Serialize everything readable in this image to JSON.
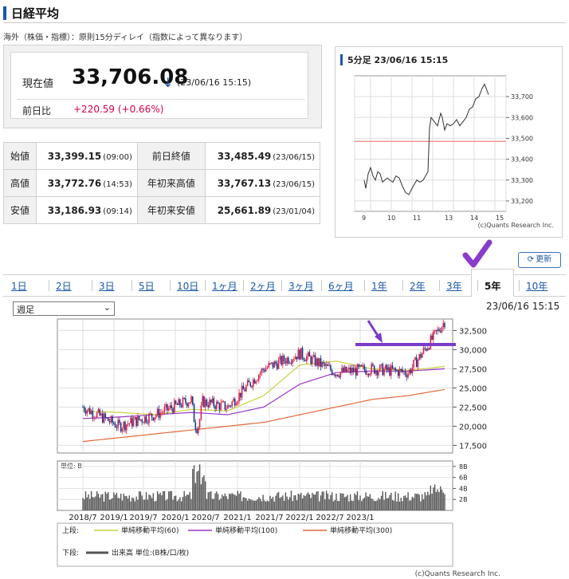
{
  "header": {
    "title": "日経平均",
    "notice": "海外（株価・指標）：原則15分ディレイ（指数によって異なります）"
  },
  "price": {
    "label": "現在値",
    "value": "33,706.08",
    "arrow": "↓",
    "time": "(23/06/16 15:15)",
    "change_label": "前日比",
    "change_value": "+220.59 (+0.66%)",
    "change_color": "#d2004f"
  },
  "stats": {
    "rows": [
      {
        "l1": "始値",
        "v1": "33,399.15",
        "t1": "(09:00)",
        "l2": "前日終値",
        "v2": "33,485.49",
        "t2": "(23/06/15)"
      },
      {
        "l1": "高値",
        "v1": "33,772.76",
        "t1": "(14:53)",
        "l2": "年初来高値",
        "v2": "33,767.13",
        "t2": "(23/06/15)"
      },
      {
        "l1": "安値",
        "v1": "33,186.93",
        "t1": "(09:14)",
        "l2": "年初来安値",
        "v2": "25,661.89",
        "t2": "(23/01/04)"
      }
    ]
  },
  "intraday": {
    "title": "5分足 23/06/16 15:15",
    "copyright": "(c)Quants Research Inc.",
    "yticks": [
      "33,700",
      "33,600",
      "33,500",
      "33,400",
      "33,300",
      "33,200"
    ],
    "xticks": [
      "9",
      "10",
      "11",
      "13",
      "14",
      "15"
    ]
  },
  "refresh": {
    "label": "更新",
    "icon": "refresh-icon"
  },
  "tabs": [
    "1日",
    "2日",
    "3日",
    "5日",
    "10日",
    "1ヶ月",
    "2ヶ月",
    "3ヶ月",
    "6ヶ月",
    "1年",
    "2年",
    "3年",
    "5年",
    "10年"
  ],
  "active_tab": "5年",
  "period_select": {
    "value": "週足"
  },
  "main_chart": {
    "time": "23/06/16 15:15",
    "yticks": [
      "32,500",
      "30,000",
      "27,500",
      "25,000",
      "22,500",
      "20,000",
      "17,500"
    ],
    "xticks": [
      "2018/7",
      "2019/1",
      "2019/7",
      "2020/1",
      "2020/7",
      "2021/1",
      "2021/7",
      "2022/1",
      "2022/7",
      "2023/1"
    ],
    "volume_unit": "単位: B",
    "volume_ticks": [
      "8B",
      "6B",
      "4B",
      "2B"
    ],
    "legend_upper": "上段:",
    "legend_lower": "下段:",
    "ma60": "単純移動平均(60)",
    "ma100": "単純移動平均(100)",
    "ma300": "単純移動平均(300)",
    "volume_legend": "出来高 単位:(B株/口/枚)",
    "copyright": "(c)Quants Research Inc.",
    "colors": {
      "ma60": "#c8d43a",
      "ma100": "#9a36c8",
      "ma300": "#e0683a",
      "up": "#e0204a",
      "down": "#1a3a8a",
      "volume": "#555555",
      "annotation": "#7a3cc8"
    }
  },
  "chart_data": {
    "type": "line",
    "x": [
      "2018/7",
      "2019/1",
      "2019/7",
      "2020/1",
      "2020/7",
      "2021/1",
      "2021/7",
      "2022/1",
      "2022/7",
      "2023/1",
      "2023/6"
    ],
    "series": [
      {
        "name": "週足",
        "values": [
          22500,
          20000,
          21500,
          23500,
          22500,
          27500,
          29500,
          27000,
          27500,
          27000,
          33700
        ]
      },
      {
        "name": "単純移動平均(60)",
        "values": [
          22000,
          21800,
          21500,
          22200,
          22000,
          24000,
          28000,
          28500,
          27500,
          27300,
          27800
        ]
      },
      {
        "name": "単純移動平均(100)",
        "values": [
          21000,
          21200,
          21500,
          21800,
          21500,
          22500,
          25500,
          27000,
          27200,
          27200,
          27500
        ]
      },
      {
        "name": "単純移動平均(300)",
        "values": [
          18000,
          18500,
          19000,
          19500,
          20000,
          20500,
          21500,
          22500,
          23500,
          24000,
          24800
        ]
      }
    ],
    "ylim": [
      16500,
      34000
    ]
  }
}
